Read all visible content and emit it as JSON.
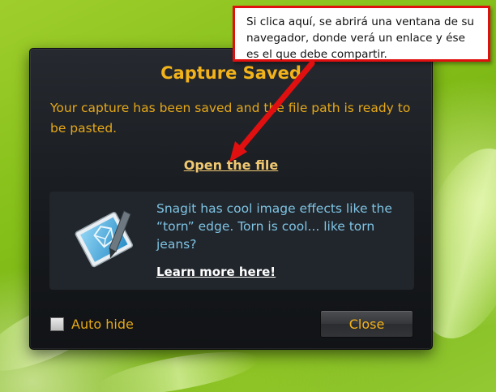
{
  "dialog": {
    "title": "Capture Saved",
    "message": "Your capture has been saved and the file path is ready to be pasted.",
    "open_link": "Open the file",
    "promo": {
      "text": "Snagit has cool image effects like the “torn” edge.  Torn is cool... like torn jeans?",
      "learn_more": "Learn more here!",
      "icon": "snagit-editor-icon"
    },
    "auto_hide_label": "Auto hide",
    "auto_hide_checked": false,
    "close_label": "Close"
  },
  "annotation": {
    "text": "Si clica aquí, se abrirá una ventana de su navegador, donde verá un enlace y ése es el que debe compartir."
  },
  "colors": {
    "title": "#f3b31a",
    "message": "#e6a817",
    "promo_text": "#7ec3e3",
    "callout_border": "#e01010",
    "arrow": "#e01010"
  }
}
